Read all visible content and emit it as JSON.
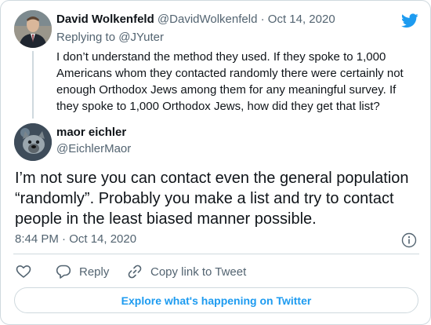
{
  "colors": {
    "brand": "#1d9bf0",
    "text": "#0f1419",
    "muted": "#536471",
    "border": "#cfd9de"
  },
  "parent_tweet": {
    "author_name": "David Wolkenfeld",
    "author_handle": "@DavidWolkenfeld",
    "separator": "·",
    "date": "Oct 14, 2020",
    "replying_prefix": "Replying to",
    "replying_to": "@JYuter",
    "text": "I don’t understand the method they used. If they spoke to 1,000 Americans whom they contacted randomly there were certainly not enough Orthodox Jews among them for any meaningful survey. If they spoke to 1,000 Orthodox Jews, how did they get that list?",
    "avatar_icon": "profile-photo"
  },
  "main_tweet": {
    "author_name": "maor eichler",
    "author_handle": "@EichlerMaor",
    "text": "I’m not sure you can contact even the general population “randomly”. Probably you make a list and try to contact people in the least biased manner possible.",
    "timestamp": "8:44 PM · Oct 14, 2020",
    "avatar_icon": "profile-photo"
  },
  "actions": {
    "like_icon": "heart-icon",
    "reply_label": "Reply",
    "copy_label": "Copy link to Tweet"
  },
  "explore_label": "Explore what's happening on Twitter"
}
